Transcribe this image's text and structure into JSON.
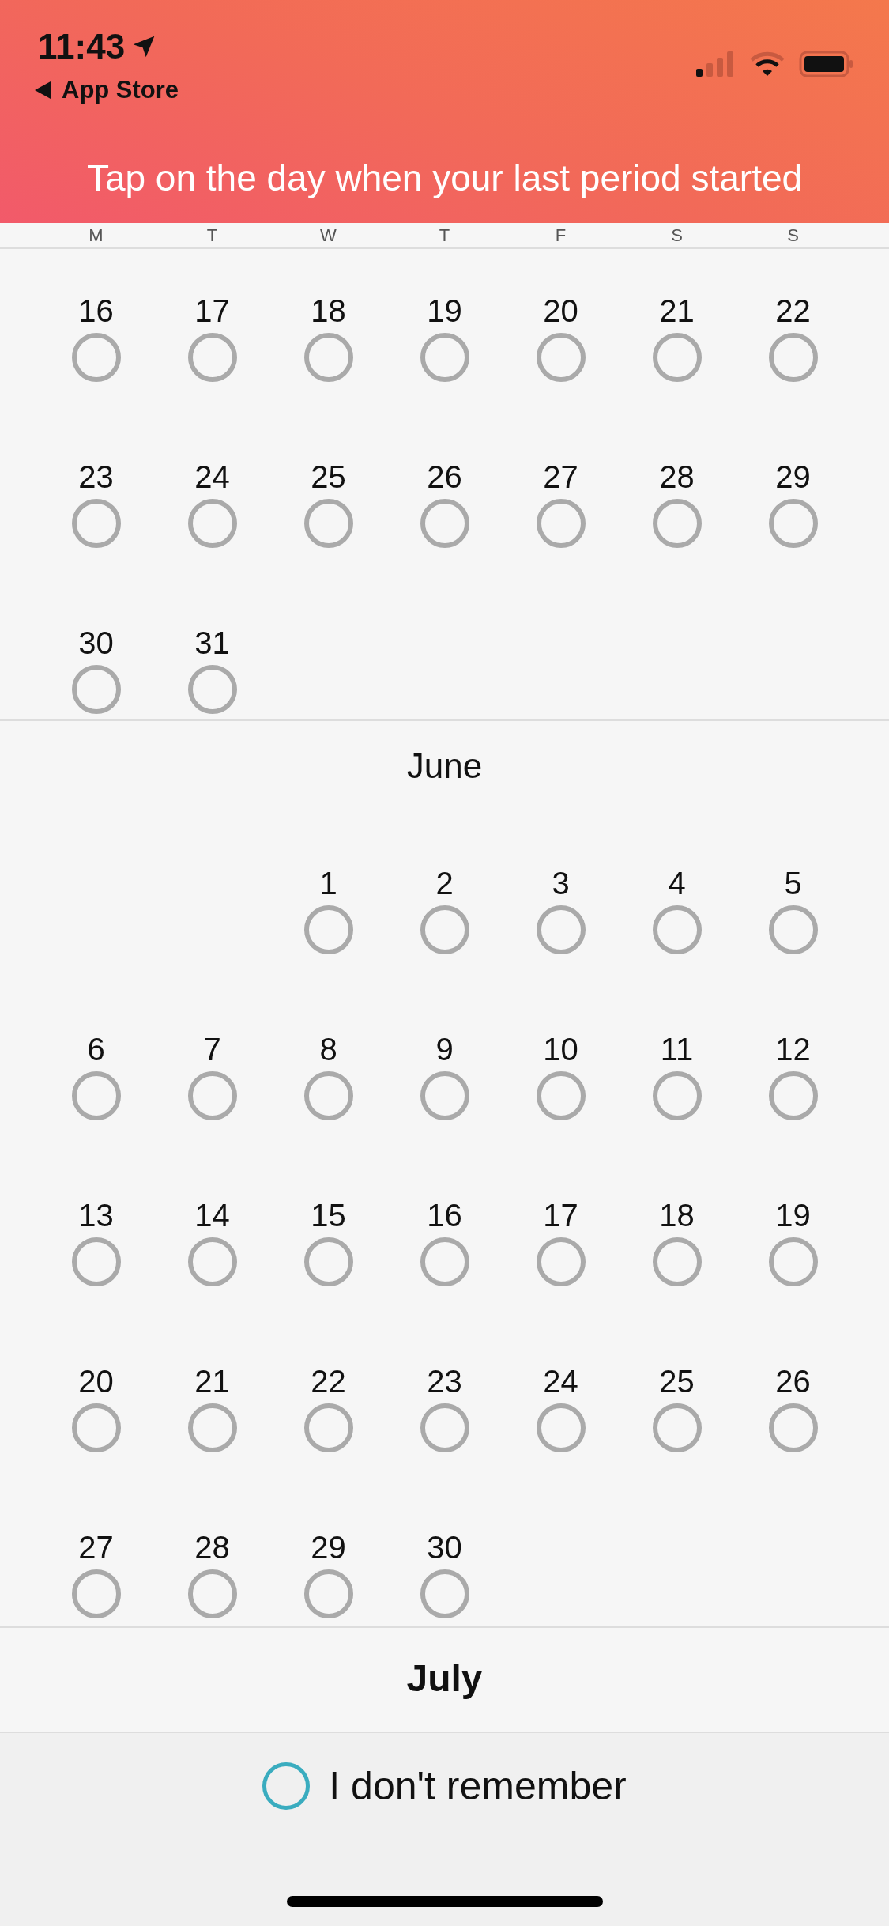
{
  "status_bar": {
    "time": "11:43",
    "back_label": "App Store"
  },
  "header": {
    "title": "Tap on the day when your last period started"
  },
  "weekdays": [
    "M",
    "T",
    "W",
    "T",
    "F",
    "S",
    "S"
  ],
  "months": [
    {
      "weeks": [
        [
          {
            "kind": "day",
            "day": "16",
            "selected": false
          },
          {
            "kind": "day",
            "day": "17",
            "selected": false
          },
          {
            "kind": "day",
            "day": "18",
            "selected": false
          },
          {
            "kind": "day",
            "day": "19",
            "selected": false
          },
          {
            "kind": "day",
            "day": "20",
            "selected": false
          },
          {
            "kind": "day",
            "day": "21",
            "selected": false
          },
          {
            "kind": "day",
            "day": "22",
            "selected": false
          }
        ],
        [
          {
            "kind": "day",
            "day": "23",
            "selected": false
          },
          {
            "kind": "day",
            "day": "24",
            "selected": false
          },
          {
            "kind": "day",
            "day": "25",
            "selected": false
          },
          {
            "kind": "day",
            "day": "26",
            "selected": false
          },
          {
            "kind": "day",
            "day": "27",
            "selected": false
          },
          {
            "kind": "day",
            "day": "28",
            "selected": false
          },
          {
            "kind": "day",
            "day": "29",
            "selected": false
          }
        ],
        [
          {
            "kind": "day",
            "day": "30",
            "selected": false
          },
          {
            "kind": "day",
            "day": "31",
            "selected": false
          }
        ]
      ]
    },
    {
      "title": "June",
      "emphasized": false,
      "weeks": [
        [
          {
            "kind": "blank"
          },
          {
            "kind": "blank"
          },
          {
            "kind": "day",
            "day": "1",
            "selected": false
          },
          {
            "kind": "day",
            "day": "2",
            "selected": false
          },
          {
            "kind": "day",
            "day": "3",
            "selected": false
          },
          {
            "kind": "day",
            "day": "4",
            "selected": false
          },
          {
            "kind": "day",
            "day": "5",
            "selected": false
          }
        ],
        [
          {
            "kind": "day",
            "day": "6",
            "selected": false
          },
          {
            "kind": "day",
            "day": "7",
            "selected": false
          },
          {
            "kind": "day",
            "day": "8",
            "selected": false
          },
          {
            "kind": "day",
            "day": "9",
            "selected": false
          },
          {
            "kind": "day",
            "day": "10",
            "selected": false
          },
          {
            "kind": "day",
            "day": "11",
            "selected": false
          },
          {
            "kind": "day",
            "day": "12",
            "selected": false
          }
        ],
        [
          {
            "kind": "day",
            "day": "13",
            "selected": false
          },
          {
            "kind": "day",
            "day": "14",
            "selected": false
          },
          {
            "kind": "day",
            "day": "15",
            "selected": false
          },
          {
            "kind": "day",
            "day": "16",
            "selected": false
          },
          {
            "kind": "day",
            "day": "17",
            "selected": false
          },
          {
            "kind": "day",
            "day": "18",
            "selected": false
          },
          {
            "kind": "day",
            "day": "19",
            "selected": false
          }
        ],
        [
          {
            "kind": "day",
            "day": "20",
            "selected": false
          },
          {
            "kind": "day",
            "day": "21",
            "selected": false
          },
          {
            "kind": "day",
            "day": "22",
            "selected": false
          },
          {
            "kind": "day",
            "day": "23",
            "selected": false
          },
          {
            "kind": "day",
            "day": "24",
            "selected": false
          },
          {
            "kind": "day",
            "day": "25",
            "selected": false
          },
          {
            "kind": "day",
            "day": "26",
            "selected": false
          }
        ],
        [
          {
            "kind": "day",
            "day": "27",
            "selected": false
          },
          {
            "kind": "day",
            "day": "28",
            "selected": false
          },
          {
            "kind": "day",
            "day": "29",
            "selected": false
          },
          {
            "kind": "day",
            "day": "30",
            "selected": false
          }
        ]
      ]
    },
    {
      "title": "July",
      "emphasized": true
    }
  ],
  "footer": {
    "option": {
      "label": "I don't remember",
      "selected": false
    }
  }
}
